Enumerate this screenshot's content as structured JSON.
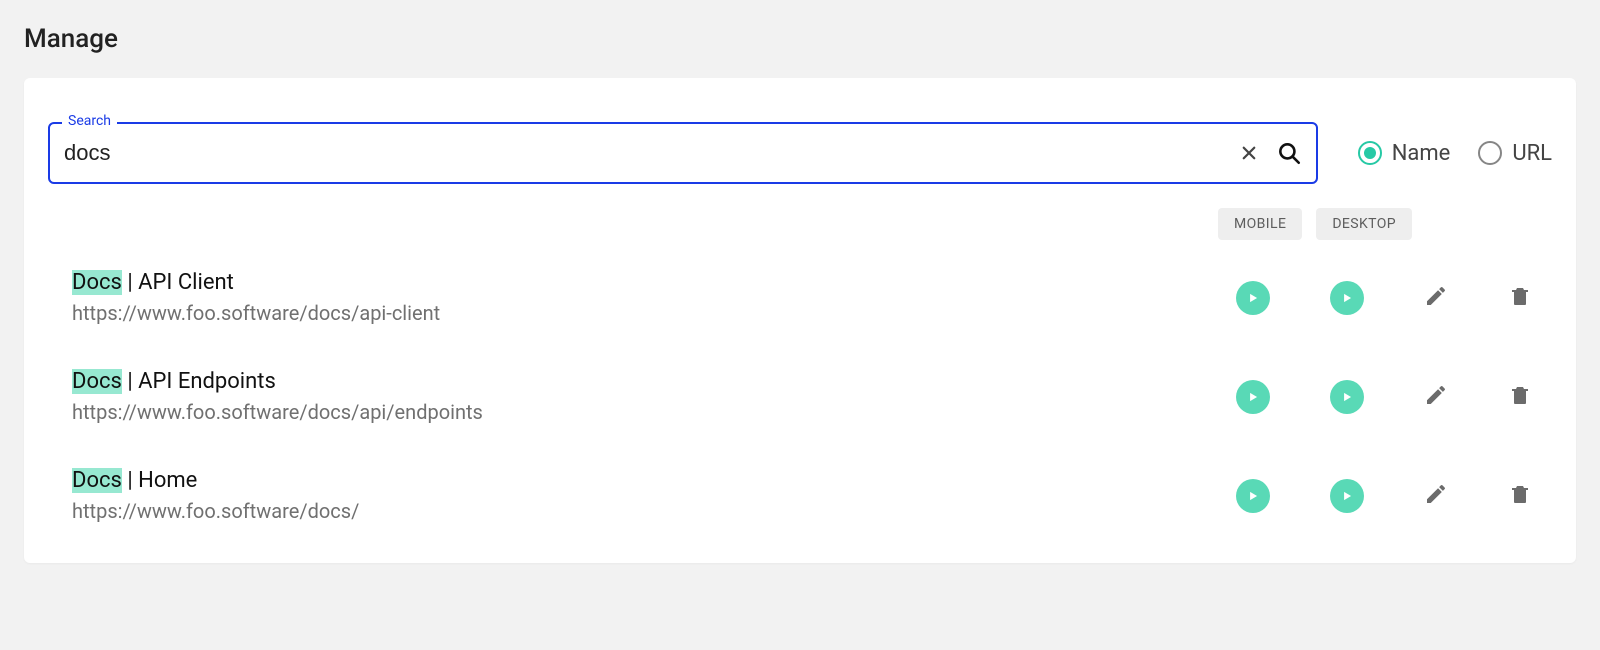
{
  "page_title": "Manage",
  "search": {
    "label": "Search",
    "value": "docs"
  },
  "search_by": {
    "selected": "name",
    "options": {
      "name": "Name",
      "url": "URL"
    }
  },
  "columns": {
    "mobile": "MOBILE",
    "desktop": "DESKTOP"
  },
  "results": [
    {
      "highlight": "Docs",
      "rest": " | API Client",
      "url": "https://www.foo.software/docs/api-client"
    },
    {
      "highlight": "Docs",
      "rest": " | API Endpoints",
      "url": "https://www.foo.software/docs/api/endpoints"
    },
    {
      "highlight": "Docs",
      "rest": " | Home",
      "url": "https://www.foo.software/docs/"
    }
  ]
}
